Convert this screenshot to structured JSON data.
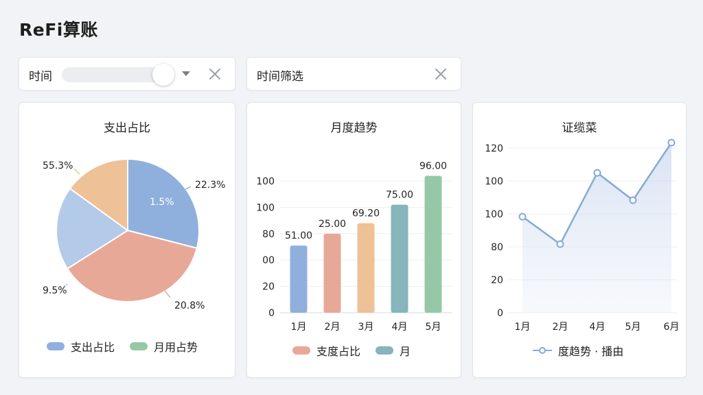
{
  "app": {
    "title": "ReFi算账"
  },
  "filters": [
    {
      "label": "时间"
    },
    {
      "label": "时间筛选"
    }
  ],
  "colors": {
    "blue": "#8fb0dc",
    "salmon": "#e8a898",
    "peach": "#efc197",
    "lightblue": "#b3cbe8",
    "teal": "#86b5bc",
    "green": "#96c8a8",
    "line": "#86a9d8"
  },
  "chart_data": [
    {
      "type": "pie",
      "title": "支出占比",
      "slices": [
        {
          "label": "22.3%",
          "value": 29,
          "color": "#8fb0dc"
        },
        {
          "label": "20.8%",
          "value": 37,
          "color": "#e8a898"
        },
        {
          "label": "9.5%",
          "value": 19,
          "color": "#b3cbe8"
        },
        {
          "label": "55.3%",
          "value": 15,
          "color": "#efc197"
        }
      ],
      "inner_label": "1.5%",
      "legend": [
        {
          "label": "支出占比",
          "color": "#8fb0dc"
        },
        {
          "label": "月用占势",
          "color": "#96c8a8"
        }
      ]
    },
    {
      "type": "bar",
      "title": "月度趋势",
      "categories": [
        "1月",
        "2月",
        "3月",
        "4月",
        "5月"
      ],
      "values": [
        51,
        60,
        68,
        82,
        104
      ],
      "value_labels": [
        "51.00",
        "25.00",
        "69.20",
        "75.00",
        "96.00"
      ],
      "colors": [
        "#8fb0dc",
        "#e8a898",
        "#efc197",
        "#86b5bc",
        "#96c8a8"
      ],
      "yticks": [
        0,
        20,
        40,
        60,
        80,
        100
      ],
      "ytick_labels": [
        "0",
        "20",
        "00",
        "80",
        "100",
        "100"
      ],
      "ylim": [
        0,
        100
      ],
      "legend": [
        {
          "label": "支度占比",
          "color": "#e8a898"
        },
        {
          "label": "月",
          "color": "#86b5bc"
        }
      ]
    },
    {
      "type": "line",
      "title": "证缆菜",
      "categories": [
        "1月",
        "2月",
        "4月",
        "5月",
        "6月"
      ],
      "values": [
        70,
        50,
        102,
        82,
        124
      ],
      "ytick_labels": [
        "0",
        "20",
        "80",
        "100",
        "100",
        "120"
      ],
      "ylim": [
        0,
        120
      ],
      "legend": [
        {
          "label": "度趋势 · 播由",
          "color": "#86a9d8"
        }
      ]
    }
  ]
}
